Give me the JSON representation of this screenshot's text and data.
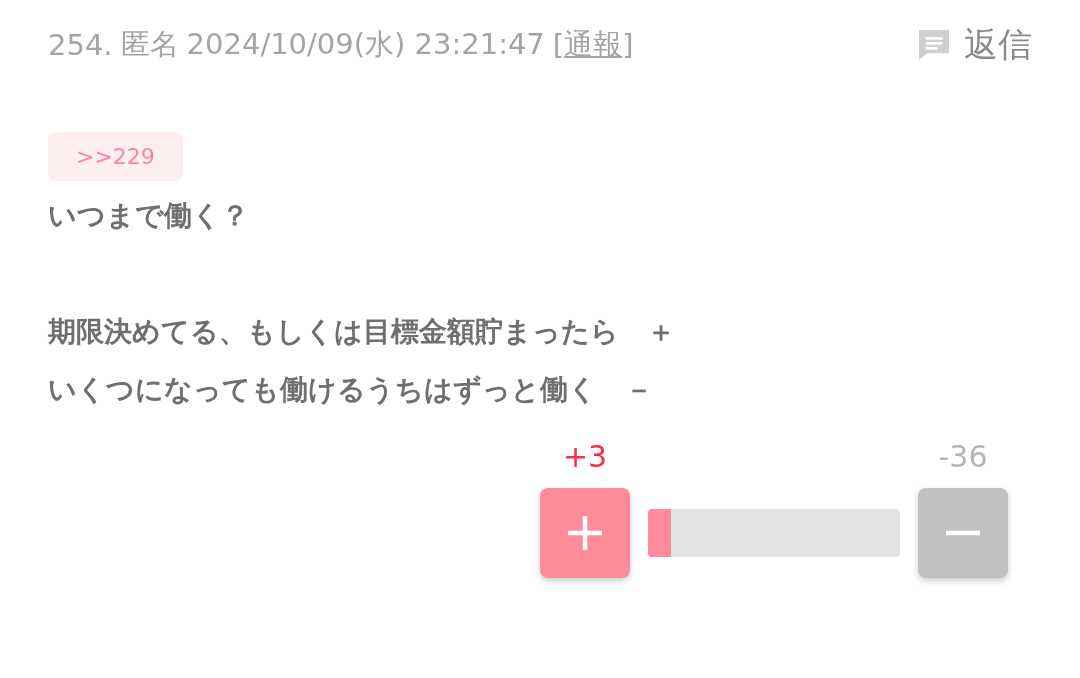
{
  "post": {
    "number": "254.",
    "author": "匿名",
    "datetime": "2024/10/09(水) 23:21:47",
    "report_link": "通報",
    "report_open": "[",
    "report_close": "]",
    "reply_button": "返信"
  },
  "quote": ">>229",
  "question": "いつまで働く？",
  "options": [
    "期限決めてる、もしくは目標金額貯まったら　＋",
    "いくつになっても働けるうちはずっと働く　－"
  ],
  "votes": {
    "plus_count": "+3",
    "minus_count": "-36",
    "level": 0.09
  }
}
